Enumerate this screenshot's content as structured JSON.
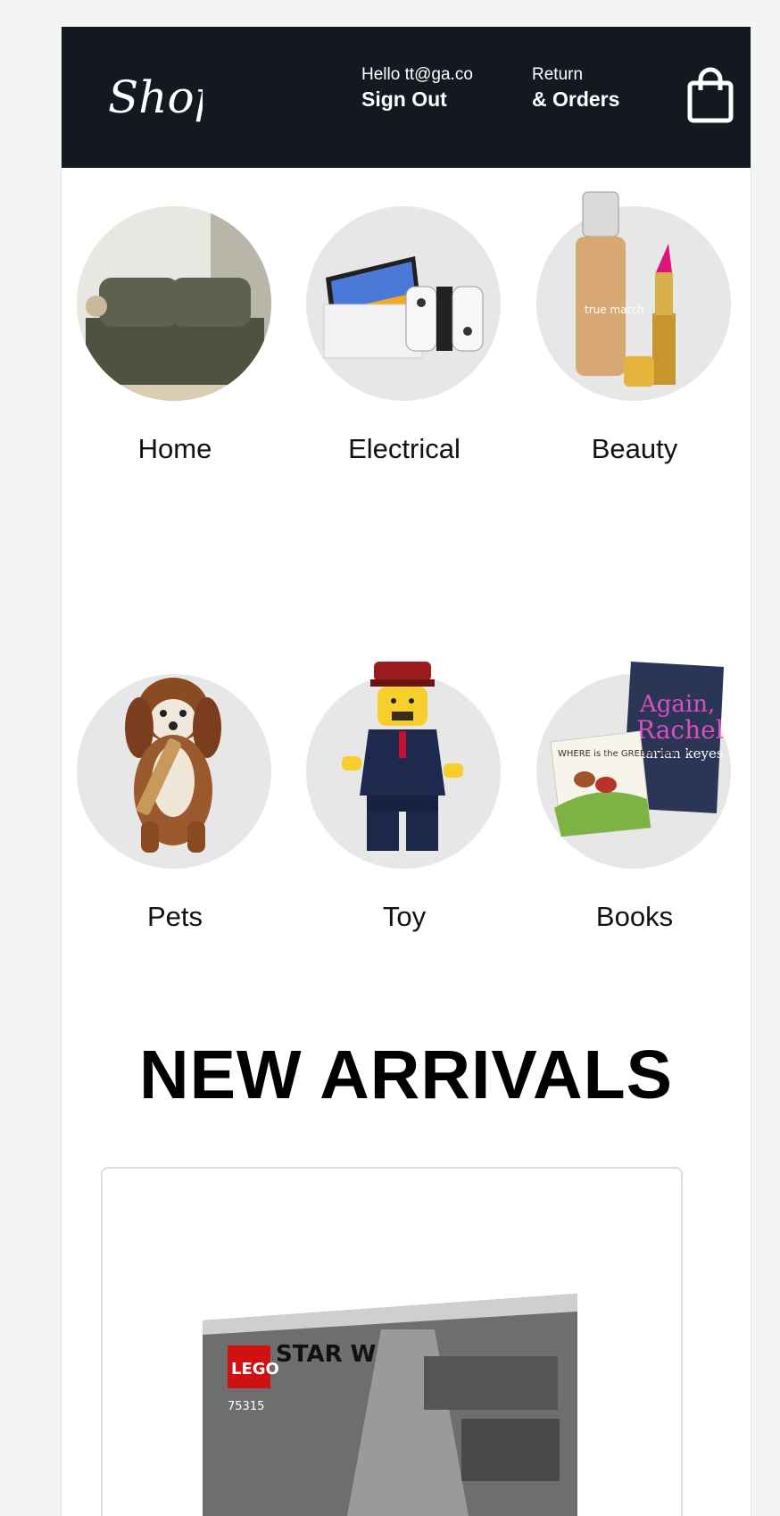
{
  "header": {
    "logo_text": "Shop",
    "greeting": "Hello tt@ga.co",
    "sign_out": "Sign Out",
    "returns_line1": "Return",
    "returns_line2": "& Orders",
    "cart_icon": "shopping-bag-icon"
  },
  "categories": [
    {
      "label": "Home"
    },
    {
      "label": "Electrical"
    },
    {
      "label": "Beauty"
    },
    {
      "label": "Pets"
    },
    {
      "label": "Toy"
    },
    {
      "label": "Books"
    }
  ],
  "book_cover": {
    "title_line1": "Again,",
    "title_line2": "Rachel",
    "author": "marian keyes"
  },
  "kids_book": {
    "title": "WHERE is the GREEN SHEEP?"
  },
  "section_title": "NEW ARRIVALS",
  "product": {
    "brand": "LEGO",
    "line": "STAR WARS",
    "number": "75315"
  },
  "colors": {
    "header_bg": "#131821",
    "circle_bg": "#e8e7e7",
    "book_accent": "#d94fc0"
  }
}
